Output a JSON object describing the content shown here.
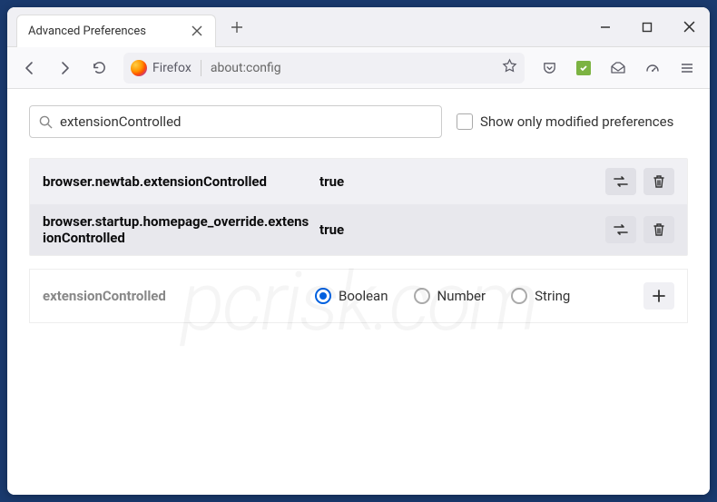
{
  "window": {
    "tab_title": "Advanced Preferences",
    "url_identity": "Firefox",
    "url": "about:config"
  },
  "search": {
    "value": "extensionControlled",
    "modified_only_label": "Show only modified preferences"
  },
  "prefs": [
    {
      "name": "browser.newtab.extensionControlled",
      "value": "true"
    },
    {
      "name": "browser.startup.homepage_override.extensionControlled",
      "value": "true"
    }
  ],
  "new_pref": {
    "name": "extensionControlled",
    "types": {
      "boolean": "Boolean",
      "number": "Number",
      "string": "String"
    },
    "selected": "boolean"
  }
}
